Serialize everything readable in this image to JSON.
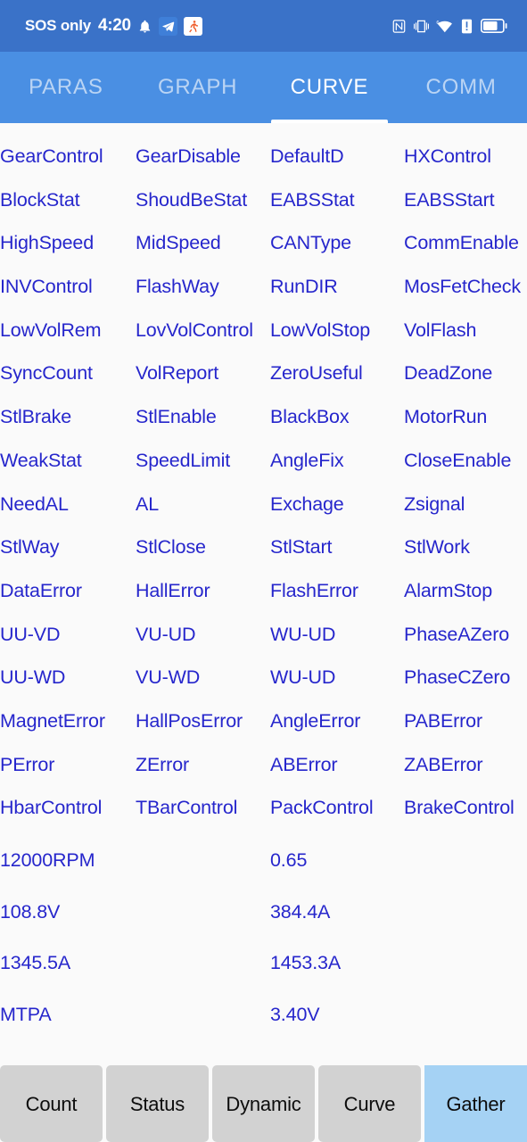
{
  "status_bar": {
    "carrier": "SOS only",
    "time": "4:20",
    "icons_left": [
      "bell-icon",
      "telegram-app-icon",
      "runner-app-icon"
    ],
    "icons_right": [
      "nfc-icon",
      "vibrate-icon",
      "wifi-6-icon",
      "alert-icon",
      "battery-icon"
    ],
    "background_color": "#3a72c8"
  },
  "tabs": {
    "items": [
      {
        "label": "PARAS",
        "active": false
      },
      {
        "label": "GRAPH",
        "active": false
      },
      {
        "label": "CURVE",
        "active": true
      },
      {
        "label": "COMM",
        "active": false
      }
    ],
    "background_color": "#4a8fe3",
    "active_color": "#ffffff"
  },
  "grid": {
    "label_color": "#2626cc",
    "columns": 4,
    "rows": [
      [
        "GearControl",
        "GearDisable",
        "DefaultD",
        "HXControl"
      ],
      [
        "BlockStat",
        "ShoudBeStat",
        "EABSStat",
        "EABSStart"
      ],
      [
        "HighSpeed",
        "MidSpeed",
        "CANType",
        "CommEnable"
      ],
      [
        "INVControl",
        "FlashWay",
        "RunDIR",
        "MosFetCheck"
      ],
      [
        "LowVolRem",
        "LovVolControl",
        "LowVolStop",
        "VolFlash"
      ],
      [
        "SyncCount",
        "VolReport",
        "ZeroUseful",
        "DeadZone"
      ],
      [
        "StlBrake",
        "StlEnable",
        "BlackBox",
        "MotorRun"
      ],
      [
        "WeakStat",
        "SpeedLimit",
        "AngleFix",
        "CloseEnable"
      ],
      [
        "NeedAL",
        "AL",
        "Exchage",
        "Zsignal"
      ],
      [
        "StlWay",
        "StlClose",
        "StlStart",
        "StlWork"
      ],
      [
        "DataError",
        "HallError",
        "FlashError",
        "AlarmStop"
      ],
      [
        "UU-VD",
        "VU-UD",
        "WU-UD",
        "PhaseAZero"
      ],
      [
        "UU-WD",
        "VU-WD",
        "WU-UD",
        "PhaseCZero"
      ],
      [
        "MagnetError",
        "HallPosError",
        "AngleError",
        "PABError"
      ],
      [
        "PError",
        "ZError",
        "ABError",
        "ZABError"
      ],
      [
        "HbarControl",
        "TBarControl",
        "PackControl",
        "BrakeControl"
      ]
    ]
  },
  "values": {
    "label_color": "#2626cc",
    "rows": [
      [
        "12000RPM",
        "0.65"
      ],
      [
        "108.8V",
        "384.4A"
      ],
      [
        "1345.5A",
        "1453.3A"
      ],
      [
        "MTPA",
        "3.40V"
      ]
    ]
  },
  "bottom_bar": {
    "buttons": [
      {
        "label": "Count",
        "selected": false
      },
      {
        "label": "Status",
        "selected": false
      },
      {
        "label": "Dynamic",
        "selected": false
      },
      {
        "label": "Curve",
        "selected": false
      },
      {
        "label": "Gather",
        "selected": true
      }
    ],
    "default_color": "#d2d2d2",
    "selected_color": "#a5d2f4"
  }
}
